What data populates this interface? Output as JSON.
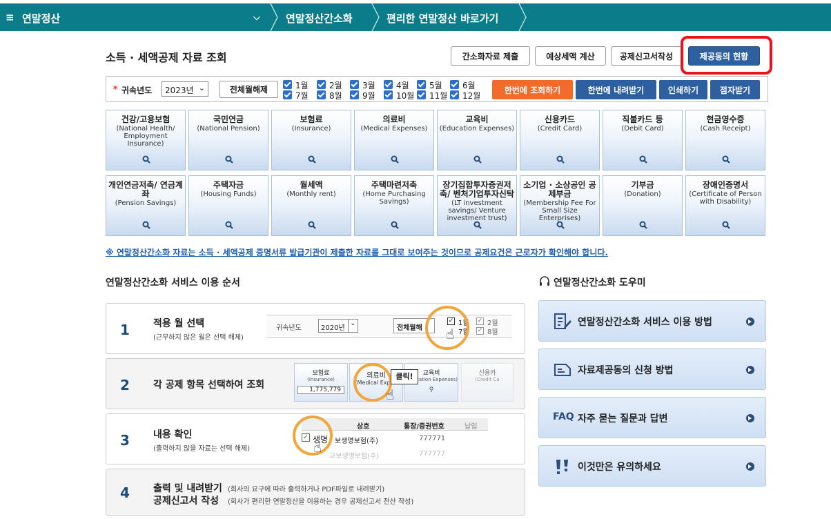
{
  "topbar": {
    "menu_title": "연말정산",
    "crumb1": "연말정산간소화",
    "crumb2": "편리한 연말정산 바로가기"
  },
  "page_title": "소득 · 세액공제 자료 조회",
  "top_buttons": {
    "simple_submit": "간소화자료 제출",
    "estimate": "예상세액 계산",
    "deduction_form": "공제신고서작성",
    "consent_status": "제공동의 현황"
  },
  "filter": {
    "year_label": "귀속년도",
    "year_value": "2023년",
    "toggle_all": "전체월해제",
    "months": [
      "1월",
      "2월",
      "3월",
      "4월",
      "5월",
      "6월",
      "7월",
      "8월",
      "9월",
      "10월",
      "11월",
      "12월"
    ],
    "lookup_all": "한번에 조회하기",
    "download_all": "한번에 내려받기",
    "print": "인쇄하기",
    "braille": "점자받기"
  },
  "colors": {
    "topbar": "#0b7d8a",
    "lookup": "#f26b2a",
    "primary": "#2e5f9e",
    "highlight": "#e8141c"
  },
  "tiles": [
    {
      "ko": "건강/고용보험",
      "en": "(National Health/ Employment Insurance)",
      "icon": "search-icon"
    },
    {
      "ko": "국민연금",
      "en": "(National Pension)",
      "icon": "search-icon"
    },
    {
      "ko": "보험료",
      "en": "(Insurance)",
      "icon": "search-icon"
    },
    {
      "ko": "의료비",
      "en": "(Medical Expenses)",
      "icon": "search-icon"
    },
    {
      "ko": "교육비",
      "en": "(Education Expenses)",
      "icon": "search-icon"
    },
    {
      "ko": "신용카드",
      "en": "(Credit Card)",
      "icon": "search-icon"
    },
    {
      "ko": "직불카드 등",
      "en": "(Debit Card)",
      "icon": "search-icon"
    },
    {
      "ko": "현금영수증",
      "en": "(Cash Receipt)",
      "icon": "search-icon"
    },
    {
      "ko": "개인연금저축/ 연금계좌",
      "en": "(Pension Savings)",
      "icon": "search-icon"
    },
    {
      "ko": "주택자금",
      "en": "(Housing Funds)",
      "icon": "search-icon"
    },
    {
      "ko": "월세액",
      "en": "(Monthly rent)",
      "icon": "search-icon"
    },
    {
      "ko": "주택마련저축",
      "en": "(Home Purchasing Savings)",
      "icon": "search-icon"
    },
    {
      "ko": "장기집합투자증권저축/ 벤처기업투자신탁",
      "en": "(LT investment savings/ Venture investment trust)",
      "icon": "search-icon"
    },
    {
      "ko": "소기업 · 소상공인 공제부금",
      "en": "(Membership Fee For Small Size Enterprises)",
      "icon": "search-icon"
    },
    {
      "ko": "기부금",
      "en": "(Donation)",
      "icon": "search-icon"
    },
    {
      "ko": "장애인증명서",
      "en": "(Certificate of Person with Disability)",
      "icon": "search-icon"
    }
  ],
  "notice": "※ 연말정산간소화 자료는 소득 · 세액공제 증명서류 발급기관이 제출한 자료를 그대로 보여주는 것이므로 공제요건은 근로자가 확인해야 합니다.",
  "steps_title": "연말정산간소화 서비스 이용 순서",
  "steps": [
    {
      "num": "1",
      "title": "적용 월 선택",
      "sub": "(근무하지 않은 월은 선택 해제)"
    },
    {
      "num": "2",
      "title": "각 공제 항목 선택하여 조회",
      "sub": ""
    },
    {
      "num": "3",
      "title": "내용 확인",
      "sub": "(출력하지 않을 자료는 선택 해제)"
    },
    {
      "num": "4",
      "title": "출력 및 내려받기",
      "sub": "(회사의 요구에 따라 출력하거나 PDF파일로 내려받기)",
      "title2": "공제신고서 작성",
      "sub2": "(회사가 편리한 연말정산을 이용하는 경우 공제신고서 전산 작성)"
    }
  ],
  "step_illustrations": {
    "s1": {
      "year_label": "귀속년도",
      "year_value": "2020년",
      "toggle_all": "전체월해",
      "m1": "1월",
      "m2": "2월",
      "m7": "7월",
      "m8": "8월"
    },
    "s2": {
      "t1": "보험료",
      "t1e": "(Insurance)",
      "amount": "1,775,779",
      "t2": "의료비",
      "t2e": "(Medical Expen",
      "click": "클릭!",
      "t3": "교육비",
      "t3e": "(Education Expenses)",
      "t4": "신용카",
      "t4e": "(Credit Ca"
    },
    "s3": {
      "col1": "상호",
      "col2": "통장/증권번호",
      "col3": "납입",
      "row_label": "생명",
      "company": "보생명보험(주)",
      "number": "777771",
      "company2": "교보생명보험(주)",
      "number2": "777777"
    }
  },
  "helper": {
    "title": "연말정산간소화 도우미",
    "items": [
      {
        "label": "연말정산간소화 서비스 이용 방법",
        "icon": "document-edit-icon"
      },
      {
        "label": "자료제공동의 신청 방법",
        "icon": "document-icon"
      },
      {
        "label": "자주 묻는 질문과 답변",
        "icon": "faq-icon",
        "badge": "FAQ"
      },
      {
        "label": "이것만은 유의하세요",
        "icon": "warning-icon"
      }
    ]
  }
}
